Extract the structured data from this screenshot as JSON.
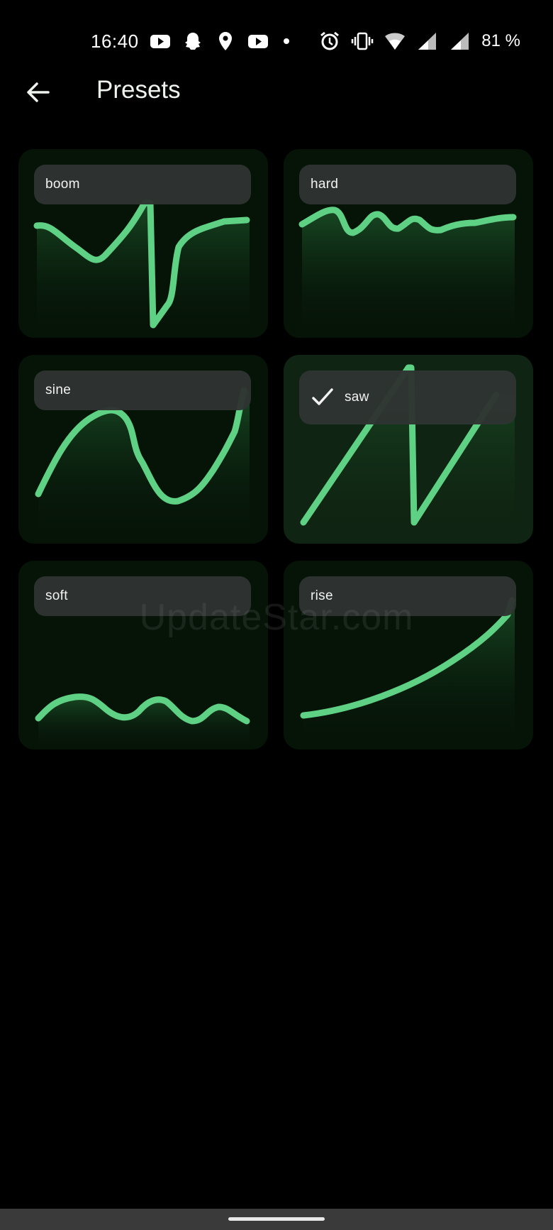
{
  "status_bar": {
    "time": "16:40",
    "battery": "81 %",
    "left_icons": [
      "youtube-icon",
      "snapchat-icon",
      "location-icon",
      "youtube-icon",
      "dot-icon"
    ],
    "right_icons": [
      "alarm-icon",
      "vibrate-icon",
      "wifi-icon",
      "signal-icon",
      "signal-icon"
    ]
  },
  "app_bar": {
    "title": "Presets",
    "back_icon": "arrow-left-icon"
  },
  "presets": [
    {
      "label": "boom",
      "selected": false
    },
    {
      "label": "hard",
      "selected": false
    },
    {
      "label": "sine",
      "selected": false
    },
    {
      "label": "saw",
      "selected": true
    },
    {
      "label": "soft",
      "selected": false
    },
    {
      "label": "rise",
      "selected": false
    }
  ],
  "watermark": "UpdateStar.com",
  "colors": {
    "background": "#000000",
    "accent": "#5fd184",
    "card": "#061408",
    "pill": "#2e3432"
  }
}
